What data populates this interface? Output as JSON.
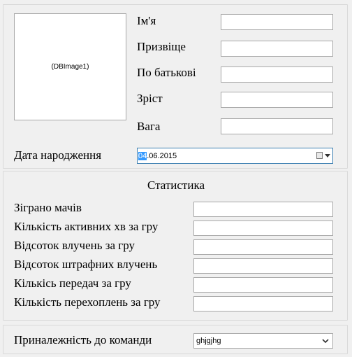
{
  "photo": {
    "caption": "(DBImage1)"
  },
  "personal": {
    "first_name_label": "Ім'я",
    "first_name_value": "",
    "last_name_label": "Призвіще",
    "last_name_value": "",
    "patronymic_label": "По батькові",
    "patronymic_value": "",
    "height_label": "Зріст",
    "height_value": "",
    "weight_label": "Вага",
    "weight_value": ""
  },
  "birth": {
    "label": "Дата народження",
    "day": "04",
    "rest": ".06.2015",
    "icon": "calendar-dropdown-icon"
  },
  "stats": {
    "title": "Статистика",
    "rows": [
      {
        "label": "Зіграно мачів",
        "value": ""
      },
      {
        "label": "Кількість активних хв за гру",
        "value": ""
      },
      {
        "label": "Відсоток влучень за гру",
        "value": ""
      },
      {
        "label": "Відсоток штрафних влучень",
        "value": ""
      },
      {
        "label": "Кількісь передач за гру",
        "value": ""
      },
      {
        "label": "Кількість перехоплень за гру",
        "value": ""
      }
    ]
  },
  "team": {
    "label": "Приналежність до команди",
    "selected": "ghjgjhg",
    "icon": "chevron-down-icon"
  },
  "colors": {
    "background": "#f0f0f0",
    "focus_border": "#3c7fb1",
    "selection": "#3399ff"
  }
}
